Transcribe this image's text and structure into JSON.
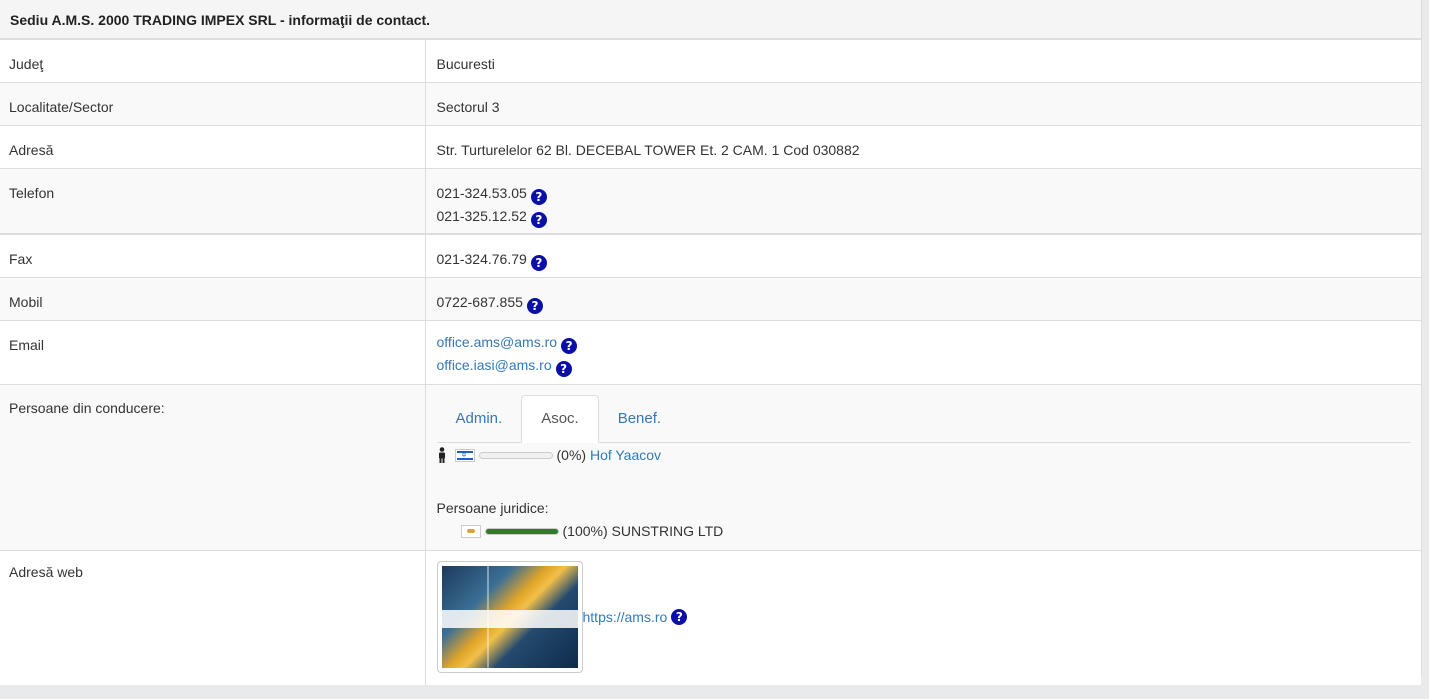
{
  "header": {
    "title": "Sediu A.M.S. 2000 TRADING IMPEX SRL - informaţii de contact."
  },
  "rows": {
    "judet": {
      "label": "Judeţ",
      "value": "Bucuresti"
    },
    "localitate": {
      "label": "Localitate/Sector",
      "value": "Sectorul 3"
    },
    "adresa": {
      "label": "Adresă",
      "value": "Str. Turturelelor 62 Bl. DECEBAL TOWER Et. 2 CAM. 1 Cod 030882"
    },
    "telefon": {
      "label": "Telefon",
      "values": [
        "021-324.53.05",
        "021-325.12.52"
      ]
    },
    "fax": {
      "label": "Fax",
      "value": "021-324.76.79"
    },
    "mobil": {
      "label": "Mobil",
      "value": "0722-687.855"
    },
    "email": {
      "label": "Email",
      "values": [
        "office.ams@ams.ro",
        "office.iasi@ams.ro"
      ]
    },
    "conducere": {
      "label": "Persoane din conducere:",
      "tabs": [
        "Admin.",
        "Asoc.",
        "Benef."
      ],
      "active_tab": "Asoc.",
      "persons": [
        {
          "share_text": "(0%)",
          "share": 0,
          "name": "Hof Yaacov",
          "flag": "il"
        }
      ],
      "juridice_label": "Persoane juridice:",
      "juridice": [
        {
          "share_text": "(100%)",
          "share": 100,
          "name": "SUNSTRING LTD",
          "flag": "cy"
        }
      ]
    },
    "web": {
      "label": "Adresă web",
      "value": "https://ams.ro"
    }
  },
  "icons": {
    "help": "?",
    "help_color": "#0a0fa8",
    "person": "person-icon"
  },
  "colors": {
    "link": "#337ab7",
    "bar_fill": "#2a7d2a"
  }
}
